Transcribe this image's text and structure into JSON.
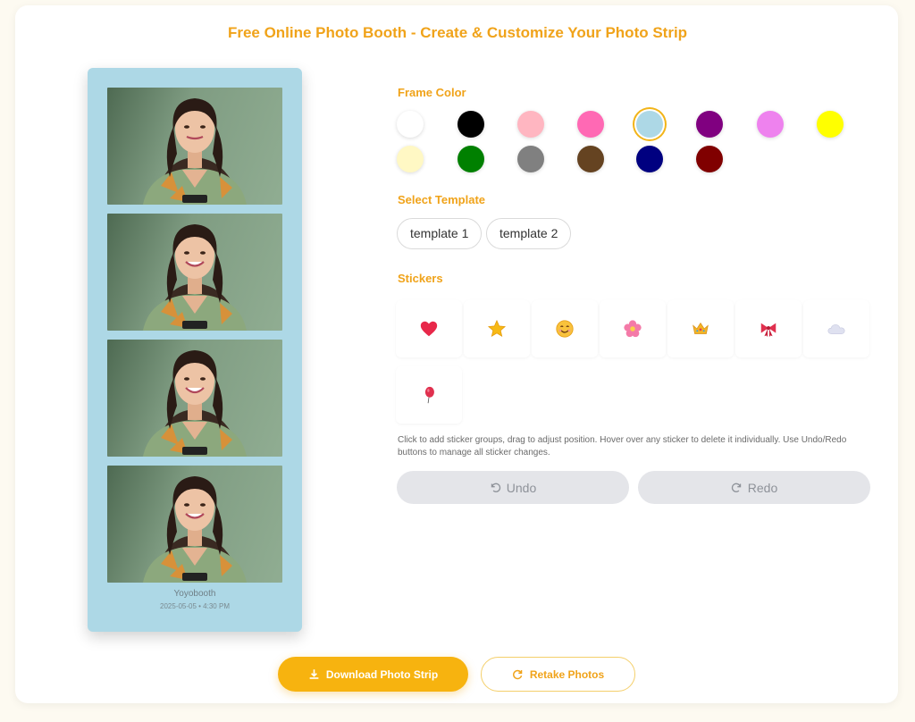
{
  "page": {
    "title": "Free Online Photo Booth - Create & Customize Your Photo Strip"
  },
  "strip": {
    "frame_color": "#add8e6",
    "brand": "Yoyobooth",
    "date": "2025-05-05 • 4:30 PM",
    "photos": [
      "photo-1",
      "photo-2",
      "photo-3",
      "photo-4"
    ]
  },
  "frame_color": {
    "label": "Frame Color",
    "selected": "#add8e6",
    "swatches": [
      "#ffffff",
      "#000000",
      "#ffb6c1",
      "#ff69b4",
      "#add8e6",
      "#800080",
      "#ee82ee",
      "#ffff00",
      "#fff8c4",
      "#008000",
      "#808080",
      "#654321",
      "#000080",
      "#800000"
    ]
  },
  "templates": {
    "label": "Select Template",
    "items": [
      "template 1",
      "template 2"
    ]
  },
  "stickers": {
    "label": "Stickers",
    "items": [
      "heart-icon",
      "star-icon",
      "smiley-icon",
      "flower-icon",
      "crown-icon",
      "bow-icon",
      "cloud-icon",
      "balloon-icon"
    ],
    "help": "Click to add sticker groups, drag to adjust position. Hover over any sticker to delete it individually. Use Undo/Redo buttons to manage all sticker changes."
  },
  "history": {
    "undo": "Undo",
    "redo": "Redo"
  },
  "actions": {
    "download": "Download Photo Strip",
    "retake": "Retake Photos"
  },
  "colors": {
    "accent": "#f0a31a",
    "button_primary": "#f7b30f",
    "disabled_bg": "#e4e5e9"
  }
}
